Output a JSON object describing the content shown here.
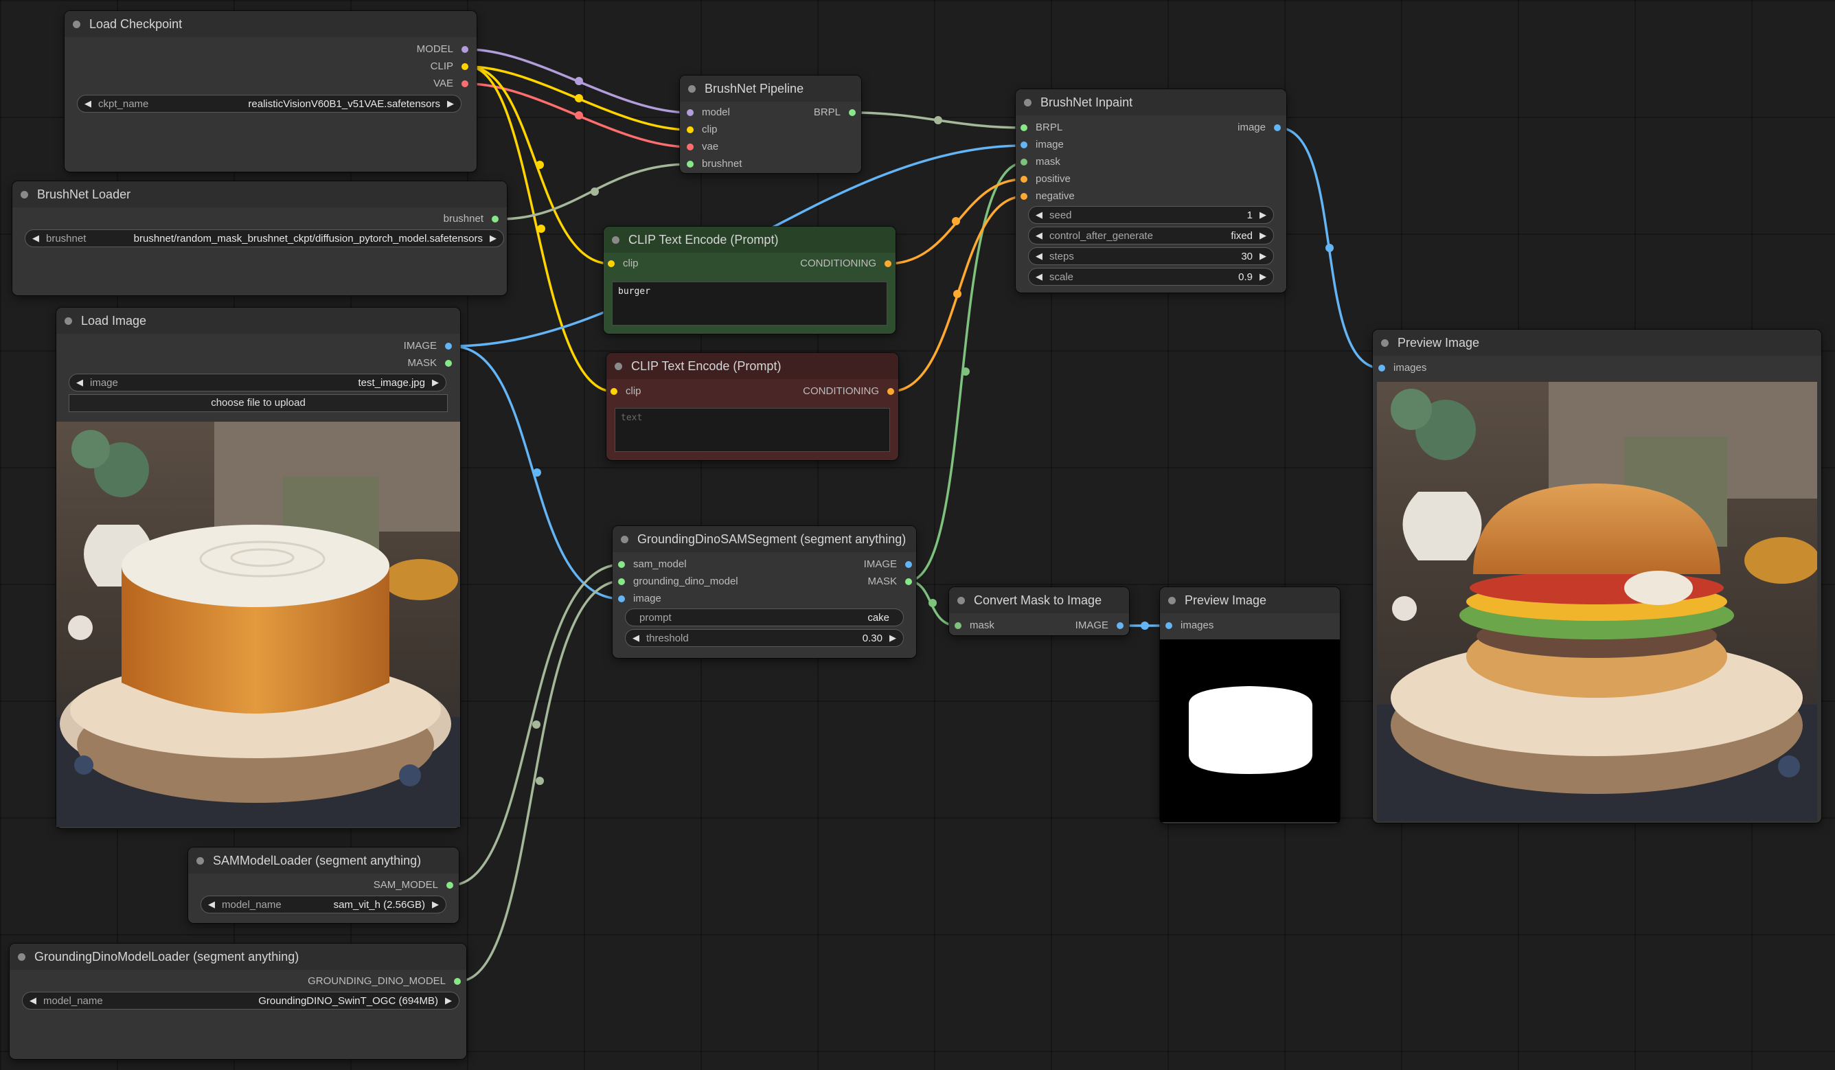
{
  "colors": {
    "model": "#b39ddb",
    "clip": "#ffd500",
    "vae": "#ff6e6e",
    "brushnet": "#a5b89a",
    "image": "#64b5f6",
    "mask": "#7ec27e",
    "conditioning": "#ffa931",
    "canvas_bg": "#1e1e1e",
    "node_bg": "#353535"
  },
  "load_checkpoint": {
    "title": "Load Checkpoint",
    "out_model": "MODEL",
    "out_clip": "CLIP",
    "out_vae": "VAE",
    "ckpt_label": "ckpt_name",
    "ckpt_value": "realisticVisionV60B1_v51VAE.safetensors"
  },
  "brushnet_loader": {
    "title": "BrushNet Loader",
    "out_brushnet": "brushnet",
    "widget_label": "brushnet",
    "widget_value": "brushnet/random_mask_brushnet_ckpt/diffusion_pytorch_model.safetensors"
  },
  "load_image": {
    "title": "Load Image",
    "out_image": "IMAGE",
    "out_mask": "MASK",
    "image_label": "image",
    "image_value": "test_image.jpg",
    "upload_button": "choose file to upload"
  },
  "brushnet_pipeline": {
    "title": "BrushNet Pipeline",
    "in_model": "model",
    "in_clip": "clip",
    "in_vae": "vae",
    "in_brushnet": "brushnet",
    "out_brpl": "BRPL"
  },
  "clip_positive": {
    "title": "CLIP Text Encode (Prompt)",
    "in_clip": "clip",
    "out_conditioning": "CONDITIONING",
    "text": "burger"
  },
  "clip_negative": {
    "title": "CLIP Text Encode (Prompt)",
    "in_clip": "clip",
    "out_conditioning": "CONDITIONING",
    "placeholder": "text"
  },
  "brushnet_inpaint": {
    "title": "BrushNet Inpaint",
    "in_brpl": "BRPL",
    "in_image": "image",
    "in_mask": "mask",
    "in_positive": "positive",
    "in_negative": "negative",
    "out_image": "image",
    "seed_label": "seed",
    "seed_value": "1",
    "cag_label": "control_after_generate",
    "cag_value": "fixed",
    "steps_label": "steps",
    "steps_value": "30",
    "scale_label": "scale",
    "scale_value": "0.9"
  },
  "gdsam_segment": {
    "title": "GroundingDinoSAMSegment (segment anything)",
    "in_sam_model": "sam_model",
    "in_gd_model": "grounding_dino_model",
    "in_image": "image",
    "out_image": "IMAGE",
    "out_mask": "MASK",
    "prompt_label": "prompt",
    "prompt_value": "cake",
    "threshold_label": "threshold",
    "threshold_value": "0.30"
  },
  "convert_mask": {
    "title": "Convert Mask to Image",
    "in_mask": "mask",
    "out_image": "IMAGE"
  },
  "preview_mask": {
    "title": "Preview Image",
    "in_images": "images"
  },
  "preview_result": {
    "title": "Preview Image",
    "in_images": "images"
  },
  "sam_loader": {
    "title": "SAMModelLoader (segment anything)",
    "out_sam_model": "SAM_MODEL",
    "model_label": "model_name",
    "model_value": "sam_vit_h (2.56GB)"
  },
  "gd_loader": {
    "title": "GroundingDinoModelLoader (segment anything)",
    "out_gd_model": "GROUNDING_DINO_MODEL",
    "model_label": "model_name",
    "model_value": "GroundingDINO_SwinT_OGC (694MB)"
  }
}
